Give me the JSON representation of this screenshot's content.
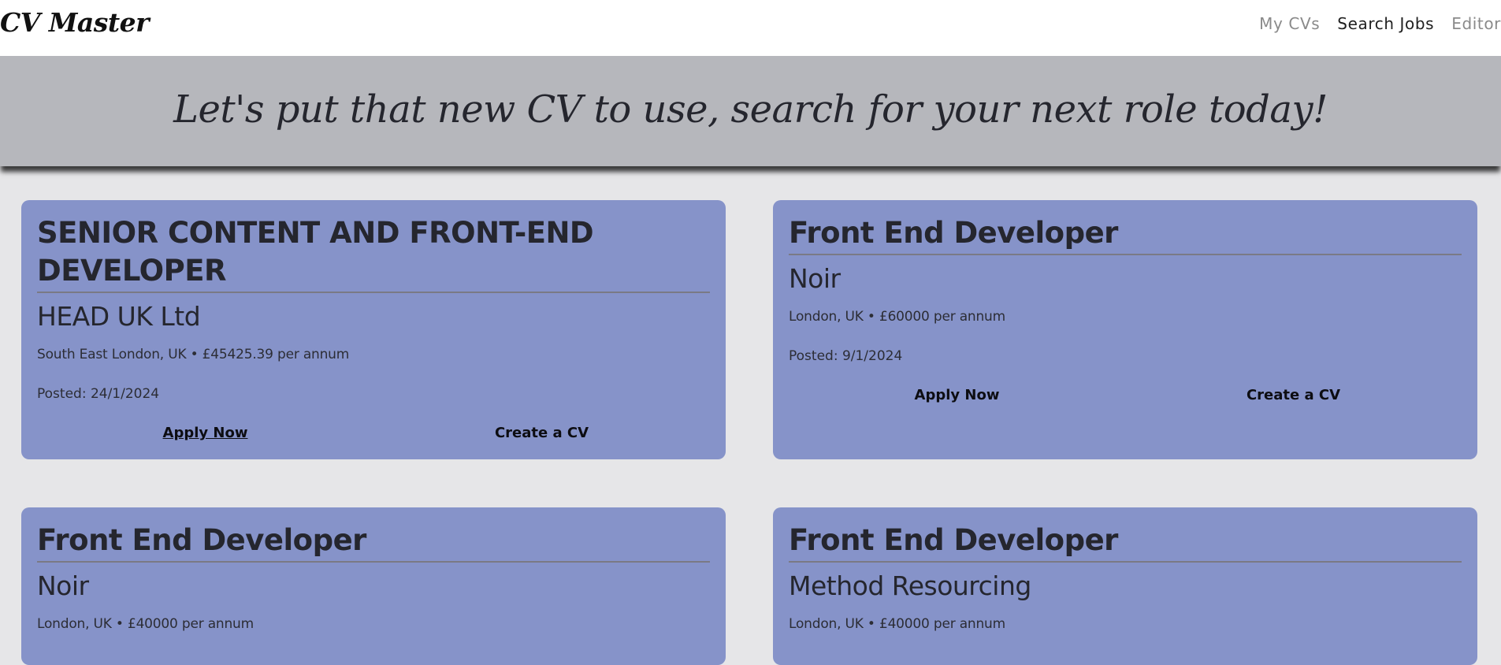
{
  "navbar": {
    "brand": "CV Master",
    "links": [
      {
        "label": "My CVs",
        "active": false
      },
      {
        "label": "Search Jobs",
        "active": true
      },
      {
        "label": "Editor",
        "active": false
      }
    ]
  },
  "hero": {
    "headline": "Let's put that new CV to use, search for your next role today!"
  },
  "jobs": [
    {
      "title": "SENIOR CONTENT AND FRONT-END DEVELOPER",
      "company": "HEAD UK Ltd",
      "meta": "South East London, UK • £45425.39 per annum",
      "posted": "Posted: 24/1/2024",
      "apply_label": "Apply Now",
      "create_label": "Create a CV"
    },
    {
      "title": "Front End Developer",
      "company": "Noir",
      "meta": "London, UK • £60000 per annum",
      "posted": "Posted: 9/1/2024",
      "apply_label": "Apply Now",
      "create_label": "Create a CV"
    },
    {
      "title": "Front End Developer",
      "company": "Noir",
      "meta": "London, UK • £40000 per annum",
      "posted": "",
      "apply_label": "",
      "create_label": ""
    },
    {
      "title": "Front End Developer",
      "company": "Method Resourcing",
      "meta": "London, UK • £40000 per annum",
      "posted": "",
      "apply_label": "",
      "create_label": ""
    }
  ],
  "colors": {
    "card_bg": "#8693c9",
    "hero_bg": "#b6b7bc",
    "page_bg": "#e6e6e8"
  }
}
